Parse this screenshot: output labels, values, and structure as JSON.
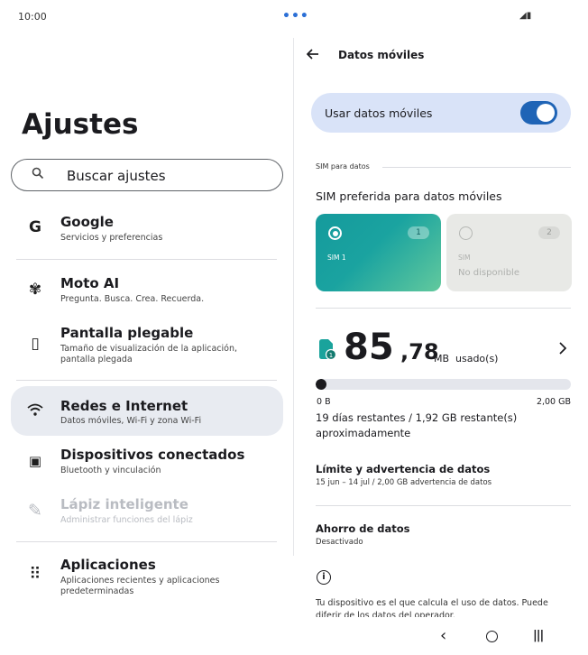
{
  "status_bar": {
    "time": "10:00",
    "dots": "•••",
    "icons": "◢▮"
  },
  "settings": {
    "title": "Ajustes",
    "search_placeholder": "Buscar ajustes",
    "items": [
      {
        "icon": "G",
        "title": "Google",
        "subtitle": "Servicios y preferencias"
      },
      {
        "icon": "✾",
        "title": "Moto AI",
        "subtitle": "Pregunta. Busca. Crea. Recuerda."
      },
      {
        "icon": "▯",
        "title": "Pantalla plegable",
        "subtitle": "Tamaño de visualización de la aplicación, pantalla plegada"
      },
      {
        "icon": "ᯤ",
        "title": "Redes e Internet",
        "subtitle": "Datos móviles, Wi-Fi y zona Wi-Fi"
      },
      {
        "icon": "▣",
        "title": "Dispositivos conectados",
        "subtitle": "Bluetooth y vinculación"
      },
      {
        "icon": "✎",
        "title": "Lápiz inteligente",
        "subtitle": "Administrar funciones del lápiz"
      },
      {
        "icon": "⠿",
        "title": "Aplicaciones",
        "subtitle": "Aplicaciones recientes y aplicaciones predeterminadas"
      }
    ]
  },
  "mobile_data": {
    "title": "Datos móviles",
    "master_label": "Usar datos móviles",
    "master_on": true,
    "section_label": "SIM para datos",
    "sim_preferred": "SIM preferida para datos móviles",
    "sims": [
      {
        "badge": "1",
        "name": "SIM 1",
        "status": "",
        "selected": true
      },
      {
        "badge": "2",
        "name": "SIM",
        "status": "No disponible",
        "selected": false
      }
    ],
    "usage": {
      "integer": "85",
      "decimal": ",78",
      "unit": "MB",
      "used_label": "usado(s)",
      "icon_badge": "1",
      "progress_fraction": 0.043,
      "min_label": "0 B",
      "max_label": "2,00 GB",
      "remaining": "19 días restantes / 1,92 GB restante(s) aproximadamente"
    },
    "limit_title": "Límite y advertencia de datos",
    "limit_subtitle": "15 jun – 14 jul / 2,00 GB advertencia de datos",
    "saver_title": "Ahorro de datos",
    "saver_subtitle": "Desactivado",
    "info_text": "Tu dispositivo es el que calcula el uso de datos. Puede diferir de los datos del operador."
  },
  "nav": {
    "back": "‹",
    "recent": "|||"
  },
  "colors": {
    "accent": "#1f64b6",
    "selected_bg": "#e8ebf1",
    "master_bg": "#d9e3f8",
    "sim_gradient_start": "#159a9c",
    "sim_gradient_end": "#62c99d"
  }
}
